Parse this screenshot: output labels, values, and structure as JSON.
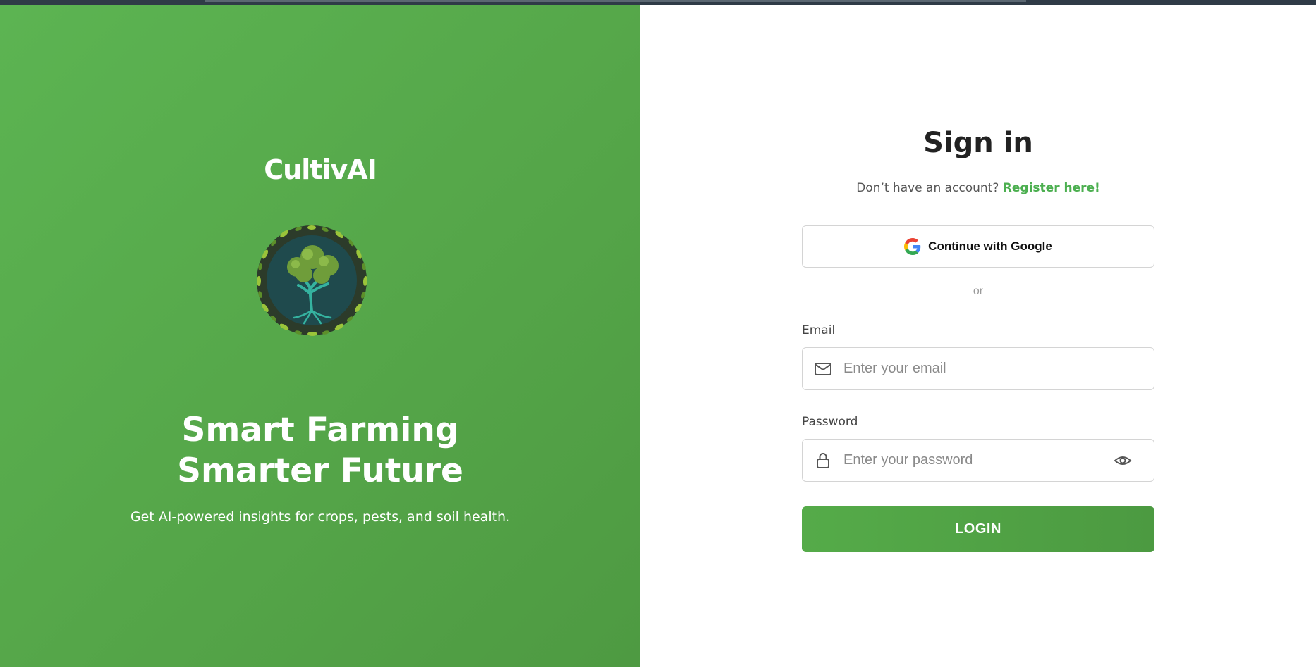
{
  "colors": {
    "brand_green": "#55a649",
    "link_green": "#4caf50",
    "text_dark": "#222222"
  },
  "hero": {
    "brand": "CultivAI",
    "logo_icon": "tree-emblem-icon",
    "headline_line1": "Smart Farming",
    "headline_line2": "Smarter Future",
    "tagline": "Get AI-powered insights for crops, pests, and soil health."
  },
  "signin": {
    "title": "Sign in",
    "no_account_text": "Don’t have an account?",
    "register_link": "Register here!",
    "google_button": "Continue with Google",
    "google_icon": "google-logo-icon",
    "divider_text": "or",
    "email": {
      "label": "Email",
      "placeholder": "Enter your email",
      "value": "",
      "icon": "mail-icon"
    },
    "password": {
      "label": "Password",
      "placeholder": "Enter your password",
      "value": "",
      "icon": "lock-icon",
      "toggle_icon": "eye-icon"
    },
    "login_button": "LOGIN"
  }
}
